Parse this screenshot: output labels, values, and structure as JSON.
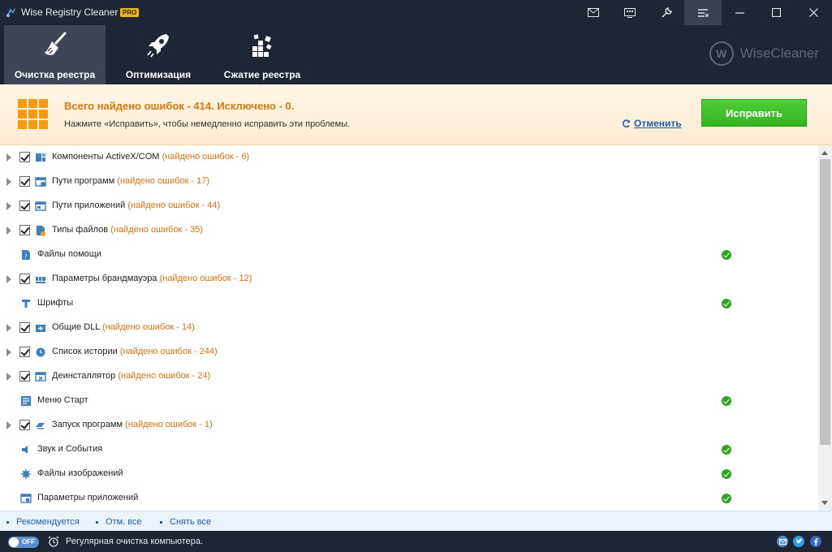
{
  "window": {
    "title": "Wise Registry Cleaner X",
    "badge": "PRO"
  },
  "nav": {
    "items": [
      {
        "label": "Очистка реестра",
        "icon": "broom-icon",
        "active": true
      },
      {
        "label": "Оптимизация",
        "icon": "rocket-icon",
        "active": false
      },
      {
        "label": "Сжатие реестра",
        "icon": "cubes-icon",
        "active": false
      }
    ],
    "brand": "WiseCleaner",
    "brand_mark": "W"
  },
  "summary": {
    "title": "Всего найдено ошибок - 414. Исключено - 0.",
    "description": "Нажмите «Исправить», чтобы немедленно исправить эти проблемы.",
    "cancel_label": "Отменить",
    "fix_label": "Исправить"
  },
  "items": [
    {
      "label": "Компоненты ActiveX/COM",
      "count": "(найдено ошибок - 6)",
      "icon": "activex-icon",
      "has_errors": true
    },
    {
      "label": "Пути программ",
      "count": "(найдено ошибок - 17)",
      "icon": "program-paths-icon",
      "has_errors": true
    },
    {
      "label": "Пути приложений",
      "count": "(найдено ошибок - 44)",
      "icon": "app-paths-icon",
      "has_errors": true
    },
    {
      "label": "Типы файлов",
      "count": "(найдено ошибок - 35)",
      "icon": "file-types-icon",
      "has_errors": true
    },
    {
      "label": "Файлы помощи",
      "count": "",
      "icon": "help-files-icon",
      "has_errors": false
    },
    {
      "label": "Параметры брандмауэра",
      "count": "(найдено ошибок - 12)",
      "icon": "firewall-icon",
      "has_errors": true
    },
    {
      "label": "Шрифты",
      "count": "",
      "icon": "fonts-icon",
      "has_errors": false
    },
    {
      "label": "Общие DLL",
      "count": "(найдено ошибок - 14)",
      "icon": "dll-icon",
      "has_errors": true
    },
    {
      "label": "Список истории",
      "count": "(найдено ошибок - 244)",
      "icon": "history-icon",
      "has_errors": true
    },
    {
      "label": "Деинсталлятор",
      "count": "(найдено ошибок - 24)",
      "icon": "uninstaller-icon",
      "has_errors": true
    },
    {
      "label": "Меню Старт",
      "count": "",
      "icon": "start-menu-icon",
      "has_errors": false
    },
    {
      "label": "Запуск программ",
      "count": "(найдено ошибок - 1)",
      "icon": "startup-icon",
      "has_errors": true
    },
    {
      "label": "Звук и События",
      "count": "",
      "icon": "sound-icon",
      "has_errors": false
    },
    {
      "label": "Файлы изображений",
      "count": "",
      "icon": "image-files-icon",
      "has_errors": false
    },
    {
      "label": "Параметры приложений",
      "count": "",
      "icon": "app-settings-icon",
      "has_errors": false
    }
  ],
  "footer": {
    "recommended": "Рекомендуется",
    "select_all": "Отм. все",
    "deselect_all": "Снять все"
  },
  "status": {
    "toggle": "OFF",
    "text": "Регулярная очистка компьютера."
  },
  "colors": {
    "accent_orange": "#e0760f",
    "fix_green": "#34b421",
    "ok_green": "#2ea521",
    "link_blue": "#1f5ea8",
    "dark": "#1e2533"
  }
}
